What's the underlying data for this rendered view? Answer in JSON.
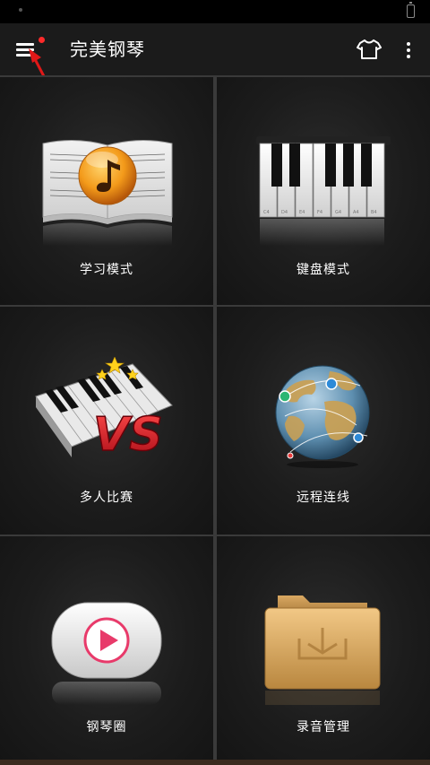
{
  "app": {
    "title": "完美钢琴"
  },
  "header": {
    "menu_icon": "hamburger-menu-icon",
    "shirt_icon": "t-shirt-icon",
    "more_icon": "more-vertical-icon",
    "badge_color": "#ff2a2a"
  },
  "tiles": [
    {
      "label": "学习模式",
      "icon": "music-book-icon"
    },
    {
      "label": "键盘模式",
      "icon": "piano-keyboard-icon"
    },
    {
      "label": "多人比赛",
      "icon": "vs-piano-icon"
    },
    {
      "label": "远程连线",
      "icon": "globe-network-icon"
    },
    {
      "label": "钢琴圈",
      "icon": "play-button-icon"
    },
    {
      "label": "录音管理",
      "icon": "folder-icon"
    }
  ],
  "piano_key_labels": [
    "C4",
    "D4",
    "E4",
    "F4",
    "G4",
    "A4",
    "B4"
  ],
  "vs_text": "VS",
  "colors": {
    "accent_orange": "#f39a1a",
    "vs_red": "#d8202b",
    "play_pink": "#e83a6a",
    "folder_tan": "#d9a862"
  }
}
